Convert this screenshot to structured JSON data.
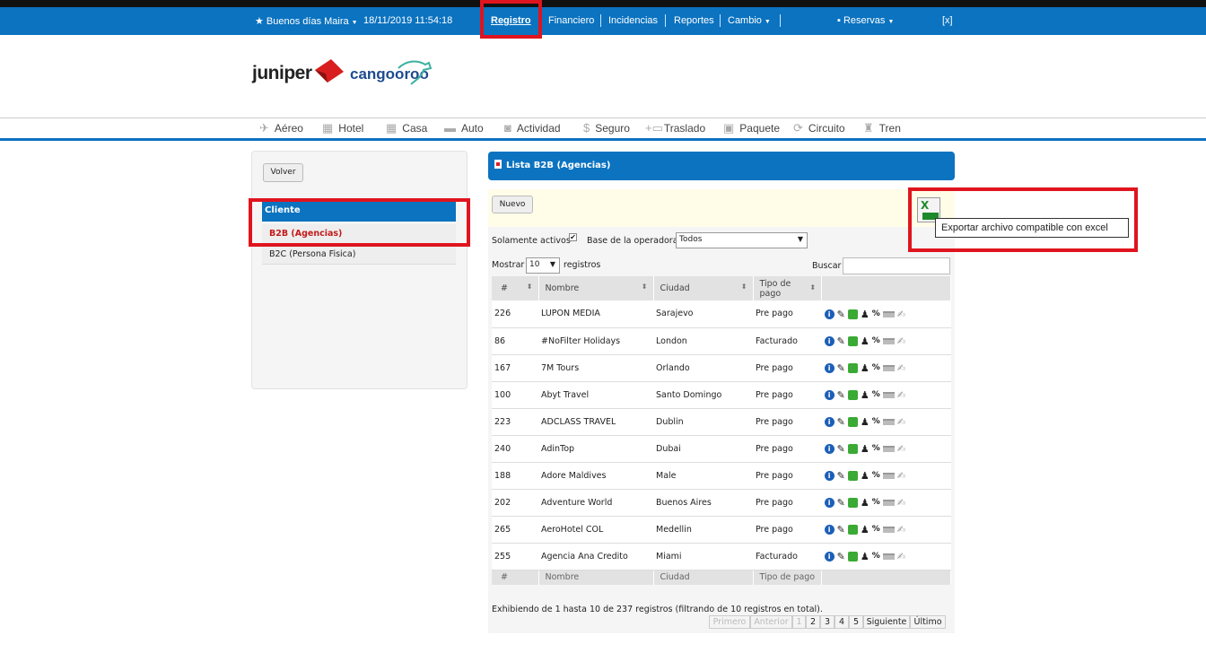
{
  "topbar": {
    "greeting": "Buenos días Maira",
    "datetime": "18/11/2019 11:54:18",
    "nav": [
      "Registro",
      "Financiero",
      "Incidencias",
      "Reportes",
      "Cambio"
    ],
    "reservas": "Reservas",
    "close": "[x]"
  },
  "brand": {
    "logo1": "juniper",
    "logo2": "cangooroo"
  },
  "products": [
    "Aéreo",
    "Hotel",
    "Casa",
    "Auto",
    "Actividad",
    "Seguro",
    "Traslado",
    "Paquete",
    "Circuito",
    "Tren"
  ],
  "sidebar": {
    "back_button": "Volver",
    "section_title": "Cliente",
    "items": [
      {
        "label": "B2B (Agencias)",
        "active": true
      },
      {
        "label": "B2C (Persona Fisica)",
        "active": false
      }
    ]
  },
  "main": {
    "title": "Lista B2B (Agencias)",
    "new_button": "Nuevo",
    "export_tooltip": "Exportar archivo compatible con excel",
    "active_only_label": "Solamente activos",
    "operator_label": "Base de la operadora",
    "operator_value": "Todos",
    "show_label": "Mostrar",
    "show_value": "10",
    "records_label": "registros",
    "search_label": "Buscar",
    "search_value": ""
  },
  "table": {
    "headers": [
      "#",
      "Nombre",
      "Ciudad",
      "Tipo de pago"
    ],
    "rows": [
      [
        "226",
        "LUPON MEDIA",
        "Sarajevo",
        "Pre pago"
      ],
      [
        "86",
        "#NoFilter Holidays",
        "London",
        "Facturado"
      ],
      [
        "167",
        "7M Tours",
        "Orlando",
        "Pre pago"
      ],
      [
        "100",
        "Abyt Travel",
        "Santo Domingo",
        "Pre pago"
      ],
      [
        "223",
        "ADCLASS TRAVEL",
        "Dublin",
        "Pre pago"
      ],
      [
        "240",
        "AdinTop",
        "Dubai",
        "Pre pago"
      ],
      [
        "188",
        "Adore Maldives",
        "Male",
        "Pre pago"
      ],
      [
        "202",
        "Adventure World",
        "Buenos Aires",
        "Pre pago"
      ],
      [
        "265",
        "AeroHotel COL",
        "Medellin",
        "Pre pago"
      ],
      [
        "255",
        "Agencia Ana Credito",
        "Miami",
        "Facturado"
      ]
    ],
    "action_icons": [
      "info-icon",
      "edit-pencil-icon",
      "green-square-icon",
      "person-icon",
      "percent-icon",
      "card-icon",
      "hand-icon"
    ]
  },
  "footer": {
    "info": "Exhibiendo de 1 hasta 10 de 237 registros (filtrando de 10 registros en total).",
    "pager": [
      "Primero",
      "Anterior",
      "1",
      "2",
      "3",
      "4",
      "5",
      "Siguiente",
      "Último"
    ]
  },
  "colors": {
    "brand_blue": "#0b73c0",
    "highlight_red": "#e0141e",
    "active_red": "#c41a1a"
  }
}
